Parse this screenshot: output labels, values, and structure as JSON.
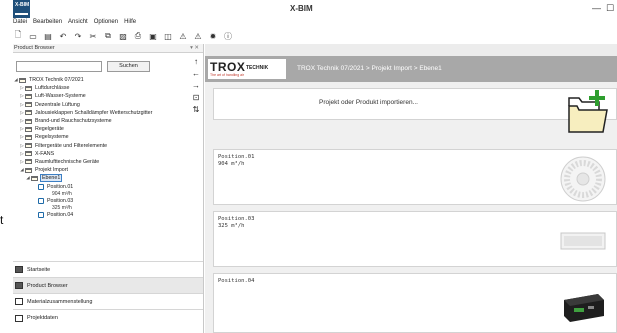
{
  "window": {
    "title": "X-BIM",
    "logo_text": "X-BIM",
    "minimize": "—",
    "maximize": "☐"
  },
  "menu": [
    "Datei",
    "Bearbeiten",
    "Ansicht",
    "Optionen",
    "Hilfe"
  ],
  "toolbar": [
    {
      "icon": "new-file-icon",
      "glyph": "🗋"
    },
    {
      "icon": "open-folder-icon",
      "glyph": "▭"
    },
    {
      "icon": "save-icon",
      "glyph": "▤"
    },
    {
      "icon": "undo-icon",
      "glyph": "↶"
    },
    {
      "icon": "redo-icon",
      "glyph": "↷"
    },
    {
      "icon": "cut-icon",
      "glyph": "✂"
    },
    {
      "icon": "copy-icon",
      "glyph": "⧉"
    },
    {
      "icon": "paste-icon",
      "glyph": "▨"
    },
    {
      "icon": "print-icon",
      "glyph": "⎙"
    },
    {
      "icon": "window-icon",
      "glyph": "▣"
    },
    {
      "icon": "window2-icon",
      "glyph": "◫"
    },
    {
      "icon": "warning-icon",
      "glyph": "⚠"
    },
    {
      "icon": "warning2-icon",
      "glyph": "⚠"
    },
    {
      "icon": "settings-icon",
      "glyph": "✹"
    },
    {
      "icon": "info-icon",
      "glyph": "ⓘ"
    }
  ],
  "left_pane": {
    "title": "Product Browser",
    "controls": "▾ ✕",
    "search": {
      "value": "",
      "button_label": "Suchen"
    },
    "tree": [
      {
        "label": "TROX Technik 07/2021",
        "level": 0,
        "expanded": true,
        "type": "folder"
      },
      {
        "label": "Luftdurchlässe",
        "level": 1,
        "expanded": false,
        "type": "folder"
      },
      {
        "label": "Luft-Wasser-Systeme",
        "level": 1,
        "expanded": false,
        "type": "folder"
      },
      {
        "label": "Dezentrale Lüftung",
        "level": 1,
        "expanded": false,
        "type": "folder"
      },
      {
        "label": "Jalousieklappen Schalldämpfer Wetterschutzgitter",
        "level": 1,
        "expanded": false,
        "type": "folder"
      },
      {
        "label": "Brand-und Rauchschutzsysteme",
        "level": 1,
        "expanded": false,
        "type": "folder"
      },
      {
        "label": "Regelgeräte",
        "level": 1,
        "expanded": false,
        "type": "folder"
      },
      {
        "label": "Regelsysteme",
        "level": 1,
        "expanded": false,
        "type": "folder"
      },
      {
        "label": "Filtergeräte und Filterelemente",
        "level": 1,
        "expanded": false,
        "type": "folder"
      },
      {
        "label": "X-FANS",
        "level": 1,
        "expanded": false,
        "type": "folder"
      },
      {
        "label": "Raumlufttechnische Geräte",
        "level": 1,
        "expanded": false,
        "type": "folder"
      },
      {
        "label": "Projekt Import",
        "level": 1,
        "expanded": true,
        "type": "folder"
      },
      {
        "label": "Ebene1",
        "level": 2,
        "expanded": true,
        "type": "folder",
        "selected": true
      }
    ],
    "positions": [
      {
        "label": "Position.01",
        "value": "904 m³/h"
      },
      {
        "label": "Position.03",
        "value": "325 m³/h"
      },
      {
        "label": "Position.04",
        "value": ""
      }
    ]
  },
  "stray_char": "t",
  "nav": [
    {
      "label": "Startseite",
      "icon": "grid-icon",
      "active": false
    },
    {
      "label": "Product Browser",
      "icon": "books-icon",
      "active": true
    },
    {
      "label": "Materialzusammenstellung",
      "icon": "list-icon",
      "active": false
    },
    {
      "label": "Projektdaten",
      "icon": "data-icon",
      "active": false
    }
  ],
  "mid_icons": [
    {
      "icon": "arrow-up-icon",
      "glyph": "↑"
    },
    {
      "icon": "arrow-left-icon",
      "glyph": "←"
    },
    {
      "icon": "arrow-right-icon",
      "glyph": "→"
    },
    {
      "icon": "add-item-icon",
      "glyph": "⊡"
    },
    {
      "icon": "sort-icon",
      "glyph": "⇅"
    }
  ],
  "content": {
    "logo": {
      "brand": "TROX",
      "suffix": "TECHNIK",
      "tagline": "The art of handling air"
    },
    "breadcrumb": "TROX Technik 07/2021 > Projekt Import > Ebene1",
    "import_label": "Projekt oder Produkt importieren...",
    "cards": [
      {
        "name": "Position.01",
        "value": "904 m³/h",
        "product": "round-diffuser-icon"
      },
      {
        "name": "Position.03",
        "value": "325 m³/h",
        "product": "linear-diffuser-icon"
      },
      {
        "name": "Position.04",
        "value": "",
        "product": "air-handling-unit-icon"
      }
    ]
  },
  "colors": {
    "banner": "#a8a8a8",
    "accent_green": "#2e9e2e",
    "folder_yellow": "#f5e6a0",
    "logo_blue": "#1f4f7a"
  }
}
